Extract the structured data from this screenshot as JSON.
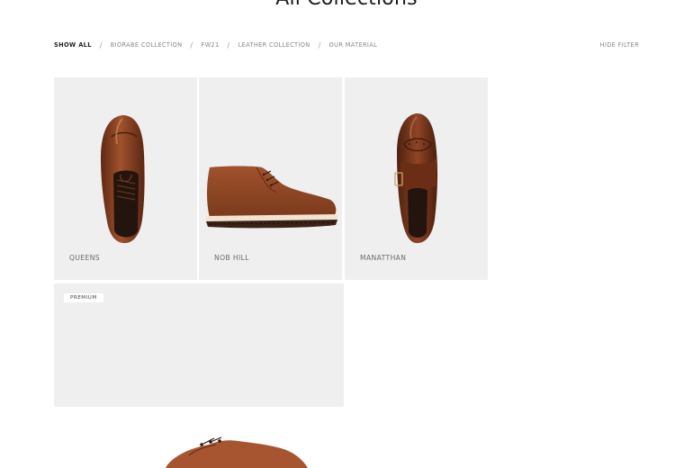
{
  "page": {
    "title": "All Collections"
  },
  "filters": {
    "items": [
      {
        "label": "SHOW ALL",
        "active": true
      },
      {
        "label": "BIORABE COLLECTION",
        "active": false
      },
      {
        "label": "FW21",
        "active": false
      },
      {
        "label": "LEATHER COLLECTION",
        "active": false
      },
      {
        "label": "OUR MATERIAL",
        "active": false
      }
    ],
    "separator": "/",
    "hide_label": "HIDE FILTER"
  },
  "products": [
    {
      "name": "QUEENS",
      "image_icon": "derby-shoe-top-view-icon"
    },
    {
      "name": "NOB HILL",
      "image_icon": "chukka-boot-side-view-icon"
    },
    {
      "name": "MANATTHAN",
      "image_icon": "monk-strap-shoe-top-view-icon"
    }
  ],
  "promo_card": {
    "badge": "PREMIUM"
  },
  "colors": {
    "card_bg": "#efefef",
    "leather": "#8a3f22",
    "leather_dark": "#5e2814",
    "sole": "#3a2217"
  }
}
